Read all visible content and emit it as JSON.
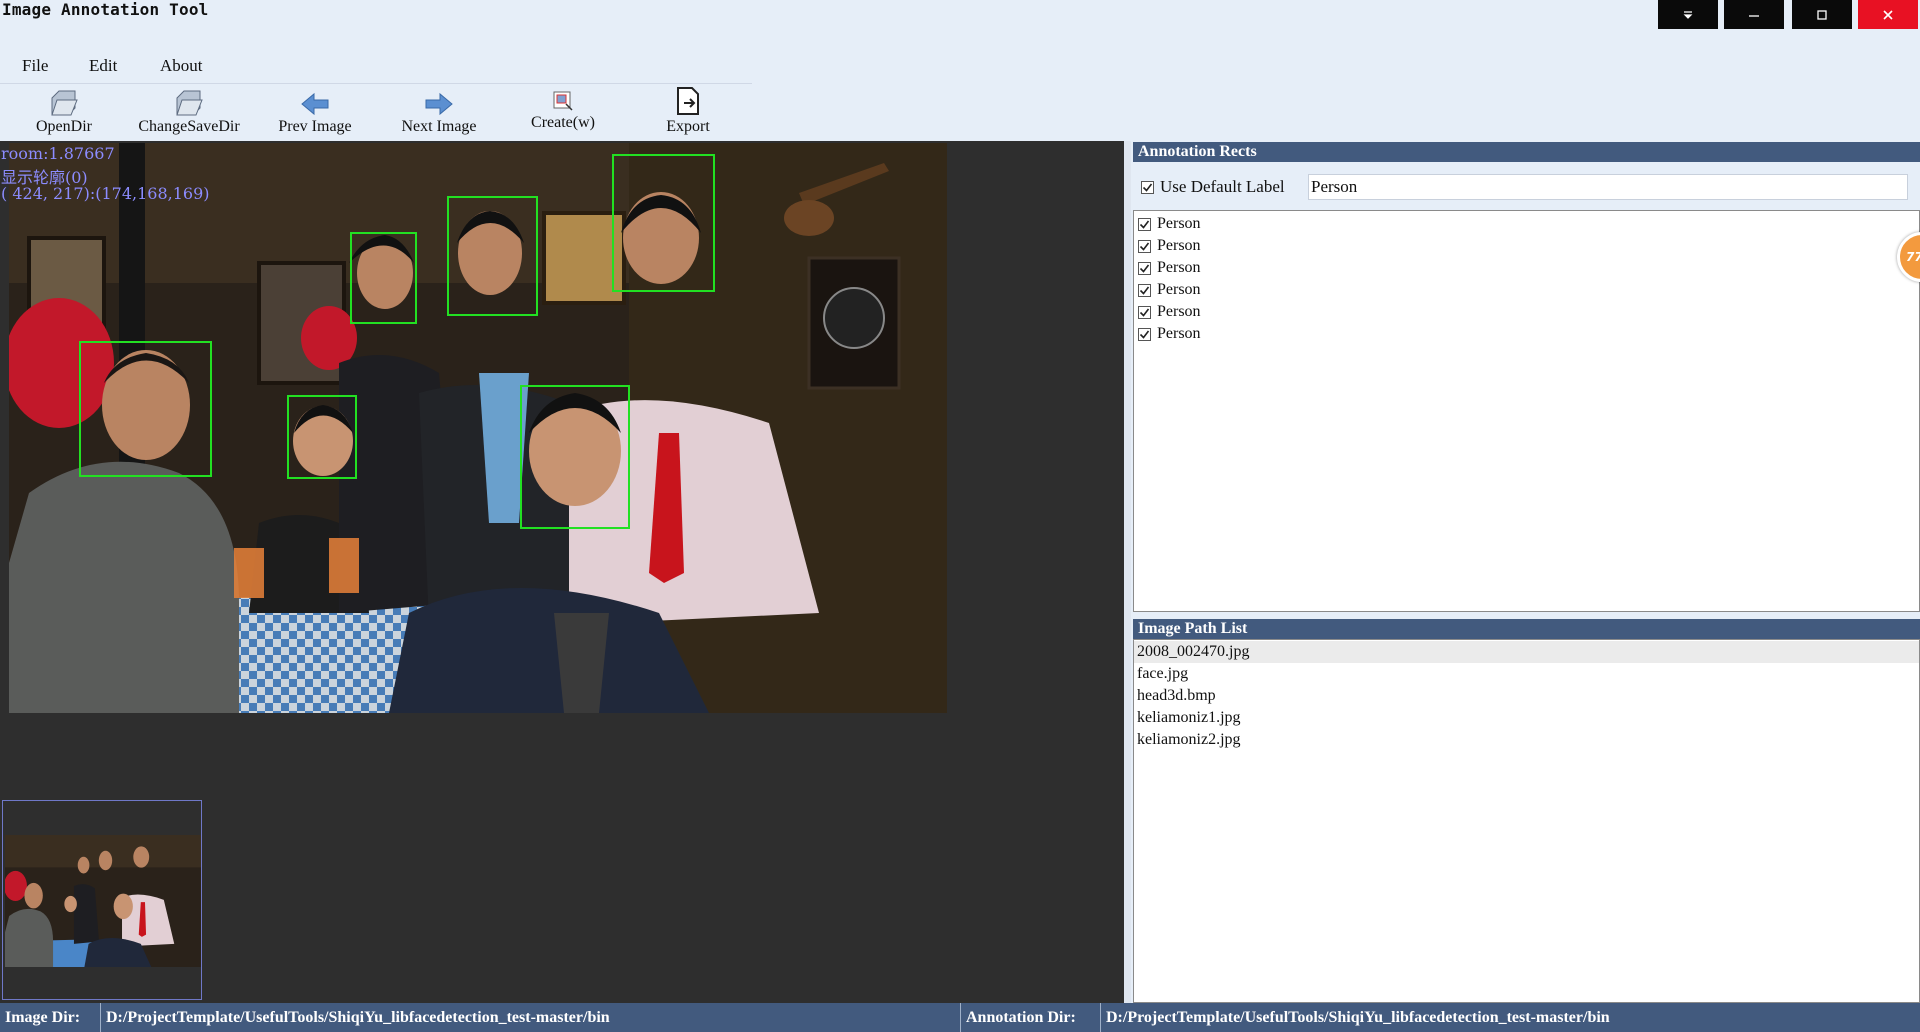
{
  "window": {
    "title": "Image Annotation Tool",
    "controls": [
      "dropdown-icon",
      "minimize-icon",
      "maximize-icon",
      "close-icon"
    ],
    "close_color": "#e81123"
  },
  "menu": {
    "file": "File",
    "edit": "Edit",
    "about": "About"
  },
  "toolbar": {
    "open_dir": "OpenDir",
    "change_save_dir": "ChangeSaveDir",
    "prev_image": "Prev Image",
    "next_image": "Next Image",
    "create": "Create(w)",
    "export": "Export"
  },
  "viewer": {
    "zoom_text": "room:1.87667",
    "contour_text": "显示轮廓(0)",
    "pixel_info": "( 424, 217):(174,168,169)",
    "box_color": "#22e022",
    "face_count": 6
  },
  "annotation_panel": {
    "header": "Annotation Rects",
    "use_default_label": "Use Default Label",
    "use_default_checked": true,
    "default_label_value": "Person",
    "rects": [
      {
        "label": "Person",
        "checked": true
      },
      {
        "label": "Person",
        "checked": true
      },
      {
        "label": "Person",
        "checked": true
      },
      {
        "label": "Person",
        "checked": true
      },
      {
        "label": "Person",
        "checked": true
      },
      {
        "label": "Person",
        "checked": true
      }
    ]
  },
  "image_list": {
    "header": "Image Path List",
    "selected_index": 0,
    "files": [
      "2008_002470.jpg",
      "face.jpg",
      "head3d.bmp",
      "keliamoniz1.jpg",
      "keliamoniz2.jpg"
    ]
  },
  "status": {
    "image_dir_label": "Image Dir:",
    "image_dir_value": "D:/ProjectTemplate/UsefulTools/ShiqiYu_libfacedetection_test-master/bin",
    "annotation_dir_label": "Annotation Dir:",
    "annotation_dir_value": "D:/ProjectTemplate/UsefulTools/ShiqiYu_libfacedetection_test-master/bin"
  },
  "floating_badge": {
    "text": "77"
  }
}
